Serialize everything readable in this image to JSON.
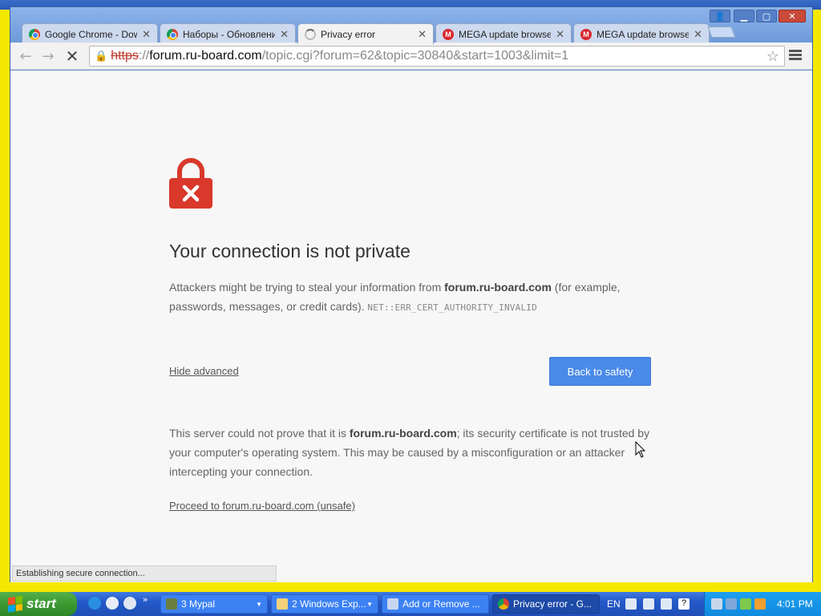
{
  "tabs": [
    {
      "title": "Google Chrome - Downlo",
      "favicon": "chrome-icon"
    },
    {
      "title": "Наборы - Обновление -",
      "favicon": "chrome-icon"
    },
    {
      "title": "Privacy error",
      "favicon": "loading-spinner-icon"
    },
    {
      "title": "MEGA update browser",
      "favicon": "mega-icon"
    },
    {
      "title": "MEGA update browser",
      "favicon": "mega-icon"
    }
  ],
  "omnibox": {
    "scheme": "https",
    "separator": "://",
    "host": "forum.ru-board.com",
    "path": "/topic.cgi?forum=62&topic=30840&start=1003&limit=1"
  },
  "page": {
    "heading": "Your connection is not private",
    "desc_pre": "Attackers might be trying to steal your information from ",
    "desc_host": "forum.ru-board.com",
    "desc_post": " (for example, passwords, messages, or credit cards). ",
    "error_code": "NET::ERR_CERT_AUTHORITY_INVALID",
    "hide_advanced": "Hide advanced",
    "back_button": "Back to safety",
    "details_pre": "This server could not prove that it is ",
    "details_host": "forum.ru-board.com",
    "details_post": "; its security certificate is not trusted by your computer's operating system. This may be caused by a misconfiguration or an attacker intercepting your connection.",
    "proceed_link": "Proceed to forum.ru-board.com (unsafe)"
  },
  "status_bar": "Establishing secure connection...",
  "taskbar": {
    "start": "start",
    "tasks": [
      {
        "label": "3 Mypal"
      },
      {
        "label": "2 Windows Exp..."
      },
      {
        "label": "Add or Remove ..."
      },
      {
        "label": "Privacy error - G..."
      }
    ],
    "language": "EN",
    "clock": "4:01 PM"
  },
  "colors": {
    "accent_button": "#4a8ae8",
    "lock_red": "#d9382b",
    "taskbar_blue": "#2459c9",
    "start_green": "#3a9a31"
  }
}
